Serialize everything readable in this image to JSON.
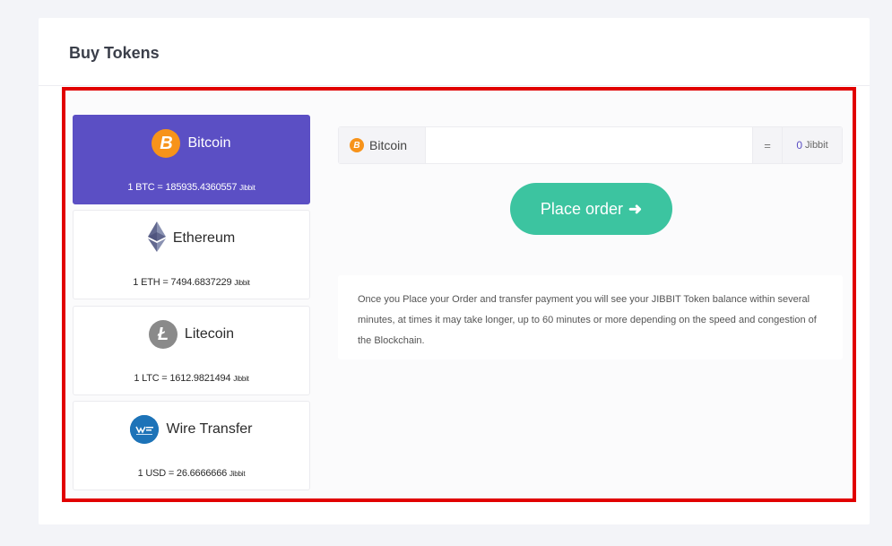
{
  "page": {
    "title": "Buy Tokens"
  },
  "coins": [
    {
      "name": "Bitcoin",
      "icon": "bitcoin-icon",
      "rate_text": "1 BTC = 185935.4360557",
      "unit": "Jibbit",
      "active": true
    },
    {
      "name": "Ethereum",
      "icon": "ethereum-icon",
      "rate_text": "1 ETH = 7494.6837229",
      "unit": "Jibbit",
      "active": false
    },
    {
      "name": "Litecoin",
      "icon": "litecoin-icon",
      "rate_text": "1 LTC = 1612.9821494",
      "unit": "Jibbit",
      "active": false
    },
    {
      "name": "Wire Transfer",
      "icon": "wire-transfer-icon",
      "rate_text": "1 USD = 26.6666666",
      "unit": "Jibbit",
      "active": false
    }
  ],
  "calculator": {
    "currency_label": "Bitcoin",
    "amount_value": "",
    "equals": "=",
    "result_value": "0",
    "result_unit": "Jibbit"
  },
  "place_order": {
    "label": "Place order"
  },
  "info_text": "Once you Place your Order and transfer payment you will see your JIBBIT Token balance within several minutes, at times it may take longer, up to 60 minutes or more depending on the speed and congestion of the Blockchain.",
  "colors": {
    "active_coin": "#5b4fc4",
    "place_order_button": "#3cc4a0",
    "highlight_border": "#e10000",
    "bitcoin": "#f7931a"
  }
}
